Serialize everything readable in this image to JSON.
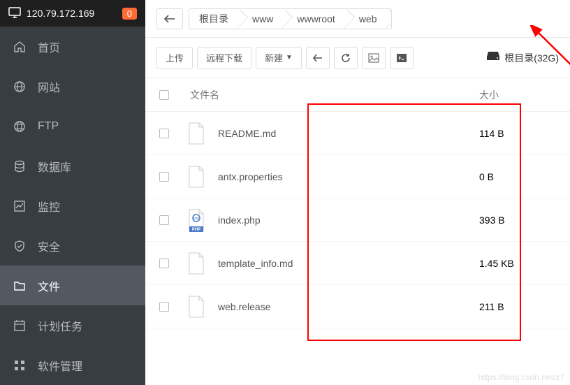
{
  "server": {
    "ip": "120.79.172.169",
    "badge": "0"
  },
  "sidebar": {
    "items": [
      {
        "label": "首页",
        "icon": "home"
      },
      {
        "label": "网站",
        "icon": "globe"
      },
      {
        "label": "FTP",
        "icon": "ftp"
      },
      {
        "label": "数据库",
        "icon": "database"
      },
      {
        "label": "监控",
        "icon": "chart"
      },
      {
        "label": "安全",
        "icon": "shield"
      },
      {
        "label": "文件",
        "icon": "folder",
        "active": true
      },
      {
        "label": "计划任务",
        "icon": "calendar"
      },
      {
        "label": "软件管理",
        "icon": "grid"
      }
    ]
  },
  "breadcrumb": [
    "根目录",
    "www",
    "wwwroot",
    "web"
  ],
  "toolbar": {
    "upload": "上传",
    "remote_download": "远程下载",
    "create": "新建"
  },
  "disk": {
    "label": "根目录(32G)"
  },
  "table": {
    "header_name": "文件名",
    "header_size": "大小",
    "rows": [
      {
        "name": "README.md",
        "size": "114 B",
        "type": "file"
      },
      {
        "name": "antx.properties",
        "size": "0 B",
        "type": "file"
      },
      {
        "name": "index.php",
        "size": "393 B",
        "type": "php"
      },
      {
        "name": "template_info.md",
        "size": "1.45 KB",
        "type": "file"
      },
      {
        "name": "web.release",
        "size": "211 B",
        "type": "file"
      }
    ]
  },
  "watermark": "https://blog.csdn.net/z7"
}
